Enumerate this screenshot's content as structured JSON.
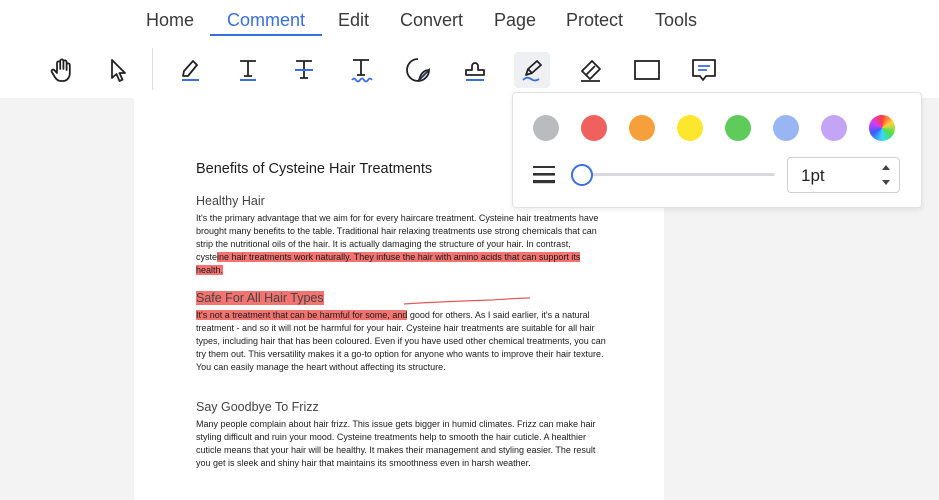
{
  "tabs": [
    {
      "label": "Home"
    },
    {
      "label": "Comment"
    },
    {
      "label": "Edit"
    },
    {
      "label": "Convert"
    },
    {
      "label": "Page"
    },
    {
      "label": "Protect"
    },
    {
      "label": "Tools"
    }
  ],
  "active_tab": "Comment",
  "toolbar": {
    "tools": [
      "hand-icon",
      "select-cursor-icon",
      "highlight-icon",
      "underline-icon",
      "strikethrough-icon",
      "squiggly-underline-icon",
      "sticky-note-icon",
      "stamp-icon",
      "pen-icon",
      "eraser-icon",
      "rectangle-icon",
      "comment-icon"
    ],
    "selected_tool": "pen-icon",
    "accent": "#3a6fe0"
  },
  "document": {
    "title": "Benefits of Cysteine Hair Treatments",
    "sections": [
      {
        "heading": "Healthy Hair",
        "body_plain": "It's the primary advantage that we aim for for every haircare treatment. Cysteine hair treatments have brought many benefits to the table. Traditional hair relaxing treatments use strong chemicals that can strip the nutritional oils of the hair. It is actually damaging the structure of your hair. In contrast, cyste",
        "body_highlight": "ine hair treatments work naturally. They infuse the hair with amino acids that can support its health."
      },
      {
        "heading": "Safe For All Hair Types",
        "body_highlight": "It's not a treatment that can be harmful for some, and",
        "body_plain": " good for others. As I said earlier, it's a natural treatment - and so it will not be harmful for your hair. Cysteine hair treatments are suitable for all hair types, including hair that has been coloured. Even if you have used other chemical treatments, you can try them out. This versatility makes it a go-to option for anyone who wants to improve their hair texture. You can easily manage the heart without affecting its structure."
      },
      {
        "heading": "Say Goodbye To Frizz",
        "body_plain": "Many people complain about hair frizz. This issue gets bigger in humid climates. Frizz can make hair styling difficult and ruin your mood. Cysteine treatments help to smooth the hair cuticle. A healthier cuticle means that your hair will be healthy. It makes their management and styling easier. The result you get is sleek and shiny hair that maintains its smoothness even in harsh weather."
      }
    ],
    "highlight_color": "#f27370",
    "ink_color": "#e05a5a"
  },
  "pen_popup": {
    "swatches": [
      "#b9bbbe",
      "#f0615d",
      "#f5a03b",
      "#fde62e",
      "#5ecb5a",
      "#98b6f4",
      "#c3a4f5",
      "rainbow"
    ],
    "width_value": "1pt",
    "width_level": 0.0
  }
}
